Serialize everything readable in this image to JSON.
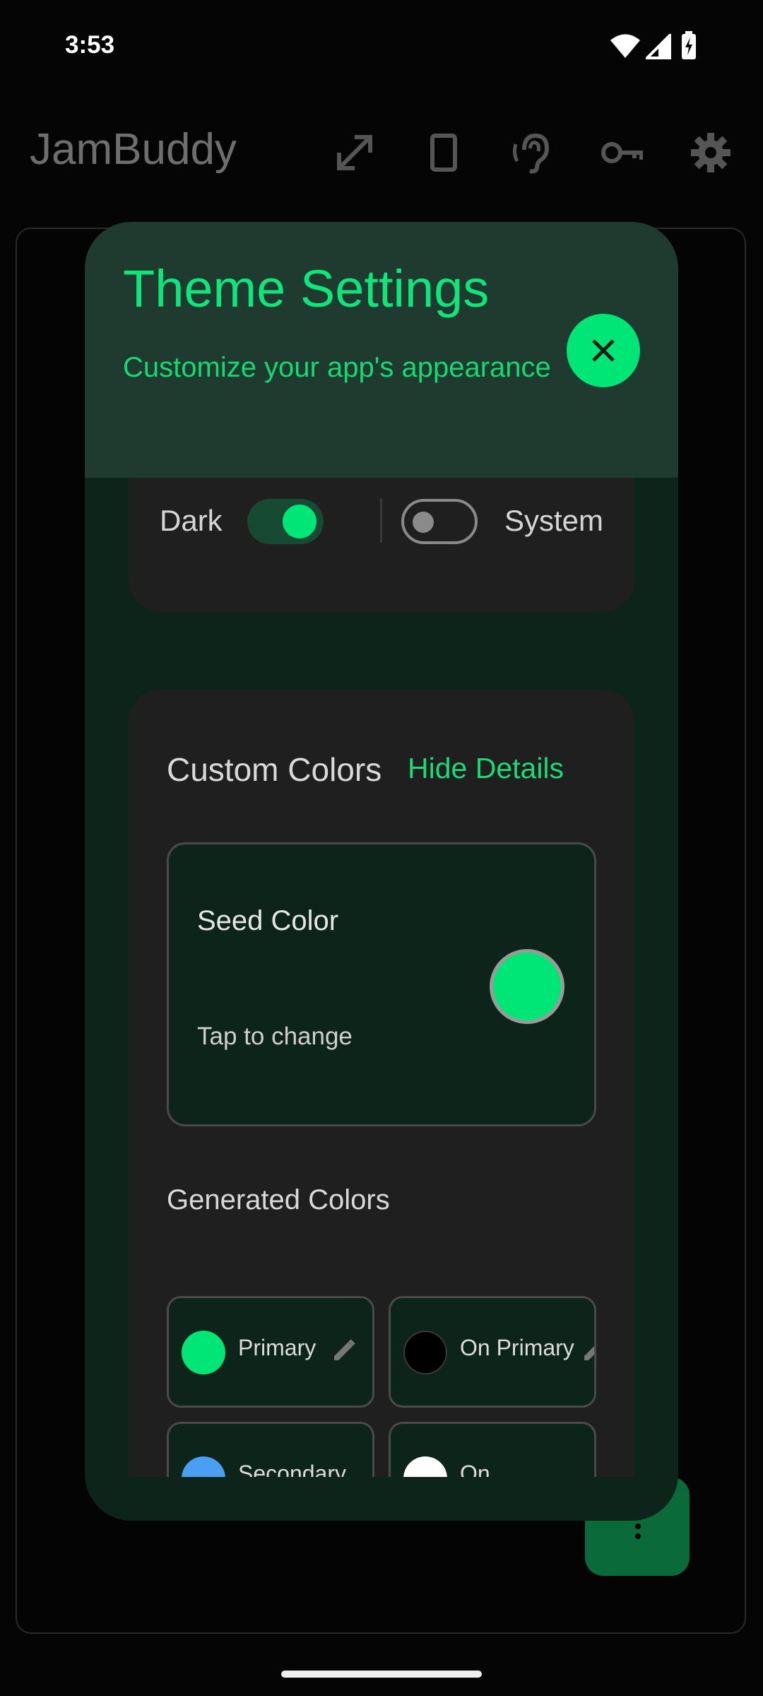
{
  "status_bar": {
    "time": "3:53",
    "icons": [
      "wifi-icon",
      "signal-icon",
      "battery-charging-icon"
    ]
  },
  "app_bar": {
    "title": "JamBuddy",
    "actions": [
      "fullscreen-icon",
      "tablet-icon",
      "hearing-icon",
      "key-icon",
      "settings-icon"
    ]
  },
  "dialog": {
    "title": "Theme Settings",
    "subtitle": "Customize your app's appearance",
    "close_icon": "close-icon",
    "mode": {
      "dark_label": "Dark",
      "dark_enabled": true,
      "system_label": "System",
      "system_enabled": false
    },
    "custom_colors": {
      "title": "Custom Colors",
      "toggle_label": "Hide Details",
      "seed": {
        "title": "Seed Color",
        "subtitle": "Tap to change",
        "color": "#00e676"
      },
      "generated_title": "Generated Colors",
      "chips": [
        {
          "label": "Primary",
          "color": "#00e676",
          "icon": "edit-icon"
        },
        {
          "label": "On Primary",
          "color": "#000000",
          "icon": "edit-icon"
        },
        {
          "label": "Secondary",
          "color": "#4a9ff5",
          "icon": "edit-icon"
        },
        {
          "label": "On",
          "color": "#ffffff",
          "icon": "edit-icon"
        }
      ]
    }
  },
  "colors": {
    "accent": "#00e676",
    "dialog_background": "#0c2419",
    "header_background": "#1f3a2e",
    "card_background": "#1f1f1f"
  }
}
